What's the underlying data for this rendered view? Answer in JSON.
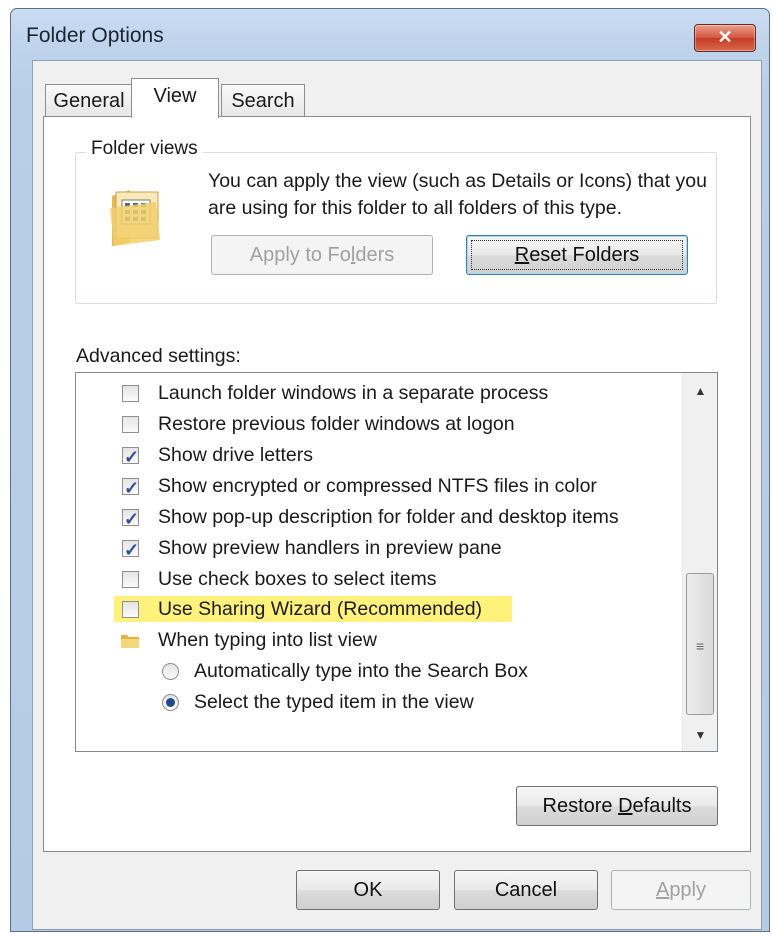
{
  "window": {
    "title": "Folder Options",
    "close_label": "✕"
  },
  "tabs": [
    {
      "label": "General",
      "active": false
    },
    {
      "label": "View",
      "active": true
    },
    {
      "label": "Search",
      "active": false
    }
  ],
  "folder_views": {
    "label": "Folder views",
    "description": "You can apply the view (such as Details or Icons) that you are using for this folder to all folders of this type.",
    "apply_button": {
      "pre": "Apply to Fo",
      "accel": "l",
      "post": "ders"
    },
    "reset_button": {
      "pre": "",
      "accel": "R",
      "post": "eset Folders"
    }
  },
  "advanced": {
    "label": "Advanced settings:",
    "items": [
      {
        "type": "checkbox",
        "label": "Launch folder windows in a separate process",
        "checked": false
      },
      {
        "type": "checkbox",
        "label": "Restore previous folder windows at logon",
        "checked": false
      },
      {
        "type": "checkbox",
        "label": "Show drive letters",
        "checked": true
      },
      {
        "type": "checkbox",
        "label": "Show encrypted or compressed NTFS files in color",
        "checked": true
      },
      {
        "type": "checkbox",
        "label": "Show pop-up description for folder and desktop items",
        "checked": true
      },
      {
        "type": "checkbox",
        "label": "Show preview handlers in preview pane",
        "checked": true
      },
      {
        "type": "checkbox",
        "label": "Use check boxes to select items",
        "checked": false
      },
      {
        "type": "checkbox",
        "label": "Use Sharing Wizard (Recommended)",
        "checked": false,
        "highlighted": true
      },
      {
        "type": "folder",
        "label": "When typing into list view"
      },
      {
        "type": "radio",
        "label": "Automatically type into the Search Box",
        "selected": false
      },
      {
        "type": "radio",
        "label": "Select the typed item in the view",
        "selected": true
      }
    ],
    "restore_button": {
      "pre": "Restore ",
      "accel": "D",
      "post": "efaults"
    }
  },
  "footer": {
    "ok": "OK",
    "cancel": "Cancel",
    "apply": {
      "pre": "",
      "accel": "A",
      "post": "pply"
    }
  },
  "colors": {
    "highlight": "#fff27a",
    "window_frame": "#b9cfe9",
    "check": "#2b4f9e"
  }
}
